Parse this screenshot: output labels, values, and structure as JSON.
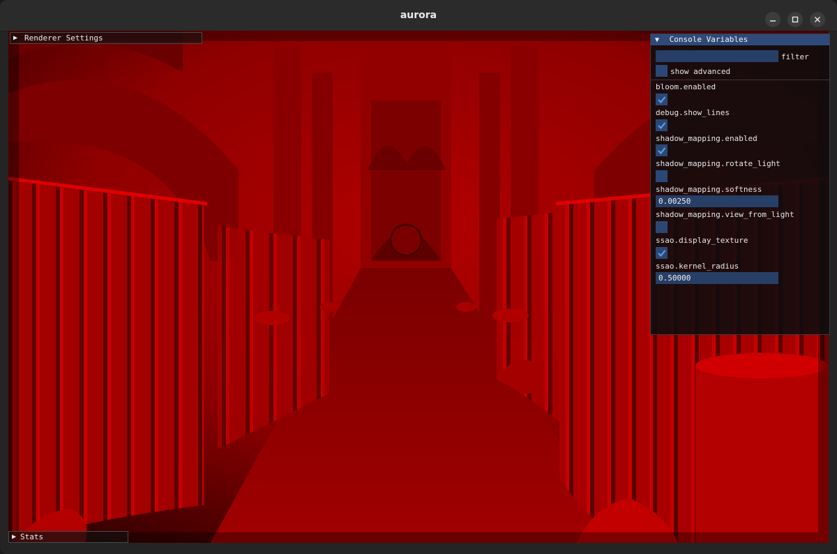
{
  "window": {
    "title": "aurora"
  },
  "panels": {
    "renderer_settings": {
      "label": "Renderer Settings",
      "expanded": false
    },
    "stats": {
      "label": "Stats",
      "expanded": false
    },
    "console_variables": {
      "label": "Console Variables",
      "expanded": true,
      "filter": {
        "value": "",
        "label": "filter"
      },
      "show_advanced": {
        "label": "show advanced",
        "checked": false
      },
      "variables": [
        {
          "name": "bloom.enabled",
          "type": "bool",
          "checked": true
        },
        {
          "name": "debug.show_lines",
          "type": "bool",
          "checked": true
        },
        {
          "name": "shadow_mapping.enabled",
          "type": "bool",
          "checked": true
        },
        {
          "name": "shadow_mapping.rotate_light",
          "type": "bool",
          "checked": false
        },
        {
          "name": "shadow_mapping.softness",
          "type": "float",
          "value": "0.00250"
        },
        {
          "name": "shadow_mapping.view_from_light",
          "type": "bool",
          "checked": false
        },
        {
          "name": "ssao.display_texture",
          "type": "bool",
          "checked": true
        },
        {
          "name": "ssao.kernel_radius",
          "type": "float",
          "value": "0.50000"
        }
      ]
    }
  },
  "colors": {
    "accent": "#2f4a79",
    "checkmark": "#5aa0e8",
    "scene_tint": "#c00000"
  }
}
